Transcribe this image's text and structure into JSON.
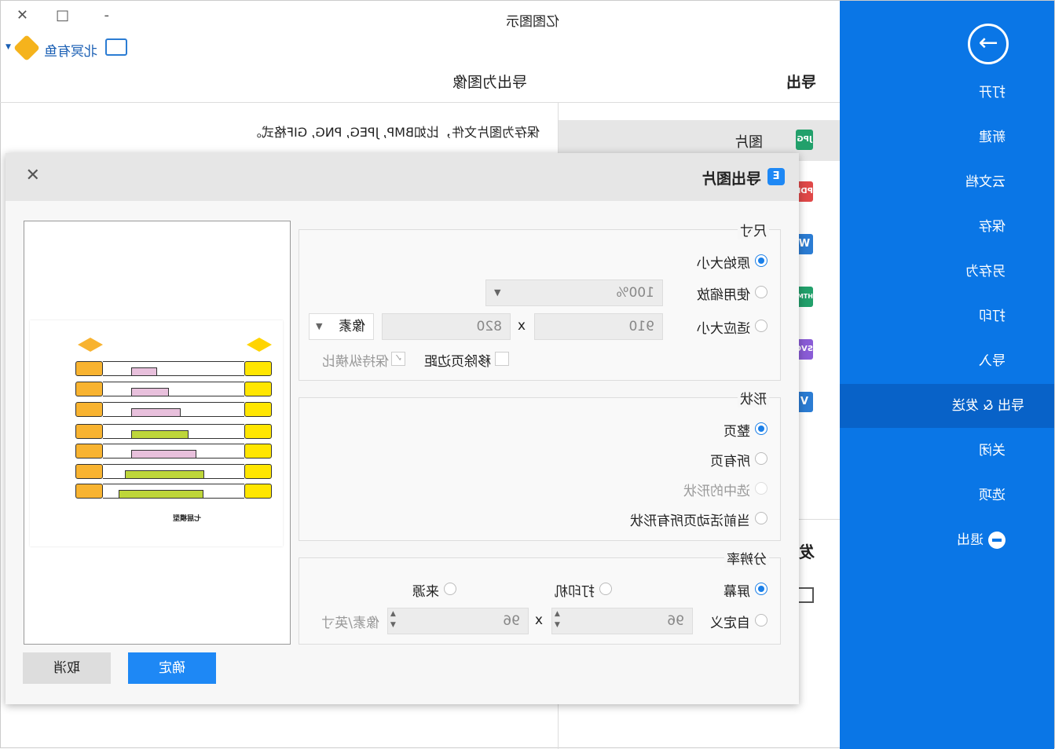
{
  "app": {
    "title": "亿图图示",
    "user": "北冥有鱼"
  },
  "window_controls": {
    "minimize": "-",
    "maximize": "□",
    "close": "✕"
  },
  "sidebar": {
    "items": [
      {
        "label": "打开"
      },
      {
        "label": "新建"
      },
      {
        "label": "云文档"
      },
      {
        "label": "保存"
      },
      {
        "label": "另存为"
      },
      {
        "label": "打印"
      },
      {
        "label": "导入"
      },
      {
        "label": "导出 & 发送",
        "active": true
      },
      {
        "label": "关闭"
      },
      {
        "label": "选项"
      },
      {
        "label": "退出"
      }
    ]
  },
  "header": {
    "section": "导出",
    "subtitle": "导出为图像"
  },
  "description": "保存为图片文件，比如BMP, JPEG, PNG, GIF格式。",
  "formats": [
    {
      "label": "图片",
      "icon": "JPG",
      "color": "#22a06b"
    },
    {
      "label": "",
      "icon": "PDF",
      "color": "#e04848"
    },
    {
      "label": "",
      "icon": "W",
      "color": "#2b7cd3"
    },
    {
      "label": "",
      "icon": "HTML",
      "color": "#22a06b"
    },
    {
      "label": "",
      "icon": "SVG",
      "color": "#8a5cd6"
    },
    {
      "label": "",
      "icon": "V",
      "color": "#2b7cd3"
    }
  ],
  "send_partial": "发",
  "dialog": {
    "title": "导出图片",
    "size": {
      "legend": "尺寸",
      "original": "原始大小",
      "zoom": "使用缩放",
      "zoom_value": "100%",
      "fit": "适应大小",
      "width": "910",
      "height": "820",
      "x": "x",
      "unit": "像素",
      "remove_margin": "移除页边距",
      "keep_ratio": "保持纵横比",
      "selected": "original"
    },
    "shape": {
      "legend": "形状",
      "whole": "整页",
      "all": "所有页",
      "selected_shapes": "选中的形状",
      "current": "当前活动页所有形状",
      "selected": "whole"
    },
    "resolution": {
      "legend": "分辨率",
      "screen": "屏幕",
      "printer": "打印机",
      "source": "来源",
      "custom": "自定义",
      "w": "96",
      "h": "96",
      "x": "x",
      "unit": "像素/英寸",
      "selected": "screen"
    },
    "preview_title": "七层模型",
    "ok": "确定",
    "cancel": "取消"
  },
  "colors": {
    "sidebar": "#0a76e6",
    "sidebar_active": "#0862c8",
    "primary_button": "#1e88f5"
  }
}
